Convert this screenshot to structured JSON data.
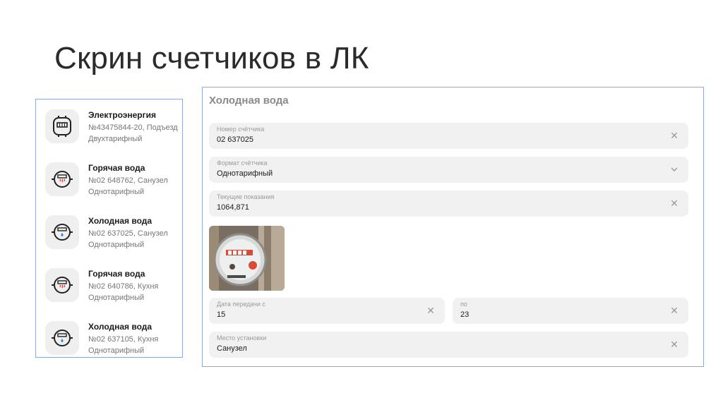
{
  "slide": {
    "title": "Скрин счетчиков в ЛК"
  },
  "meters": [
    {
      "title": "Электроэнергия",
      "line1": "№43475844-20, Подъезд",
      "line2": "Двухтарифный",
      "icon": "electric-meter-icon"
    },
    {
      "title": "Горячая вода",
      "line1": "№02 648762, Санузел",
      "line2": "Однотарифный",
      "icon": "hot-water-meter-icon"
    },
    {
      "title": "Холодная вода",
      "line1": "№02 637025, Санузел",
      "line2": "Однотарифный",
      "icon": "cold-water-meter-icon"
    },
    {
      "title": "Горячая вода",
      "line1": "№02 640786, Кухня",
      "line2": "Однотарифный",
      "icon": "hot-water-meter-icon"
    },
    {
      "title": "Холодная вода",
      "line1": "№02 637105, Кухня",
      "line2": "Однотарифный",
      "icon": "cold-water-meter-icon"
    }
  ],
  "form": {
    "title": "Холодная вода",
    "meter_number": {
      "label": "Номер счётчика",
      "value": "02 637025",
      "icon": "close-icon"
    },
    "meter_format": {
      "label": "Формат счётчика",
      "value": "Однотарифный",
      "icon": "chevron-down-icon"
    },
    "reading": {
      "label": "Текущие показания",
      "value": "1064,871",
      "icon": "close-icon"
    },
    "photo": {
      "icon": "meter-photo"
    },
    "date_from": {
      "label": "Дата передачи с",
      "value": "15",
      "icon": "close-icon"
    },
    "date_to": {
      "label": "по",
      "value": "23",
      "icon": "close-icon"
    },
    "location": {
      "label": "Место установки",
      "value": "Санузел",
      "icon": "close-icon"
    }
  },
  "colors": {
    "panel_border": "#8fa9d6",
    "field_bg": "#f1f1f1",
    "hot": "#e0442a",
    "cold": "#2a7fe0"
  }
}
